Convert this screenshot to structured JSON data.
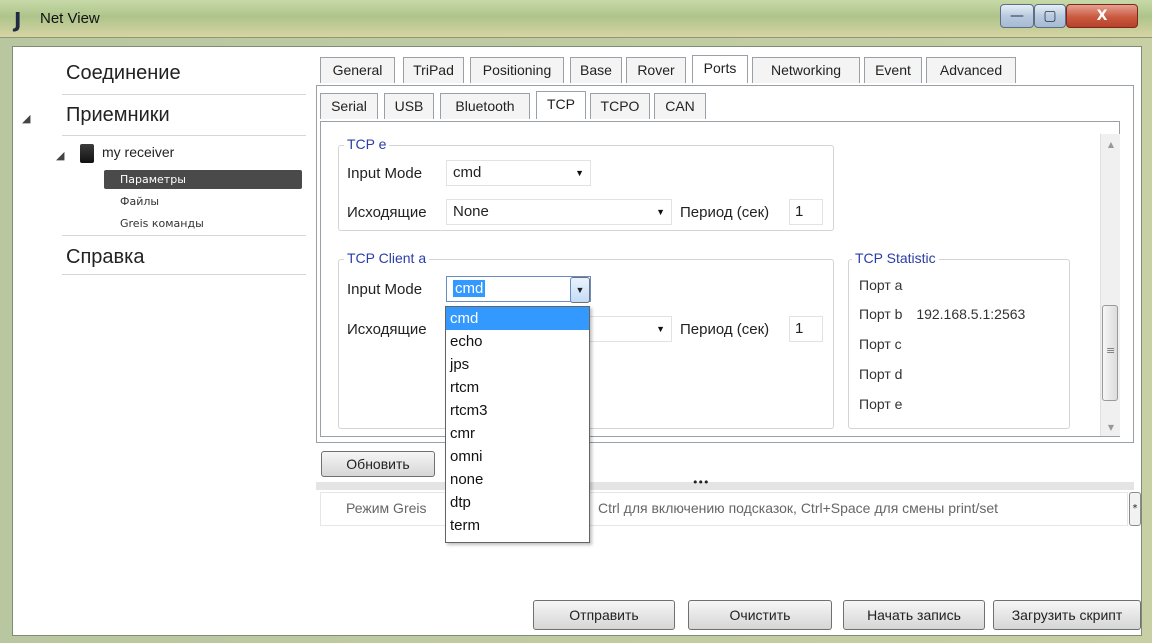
{
  "window": {
    "title": "Net View",
    "logo_glyph": "J",
    "minimize_glyph": "—",
    "maximize_glyph": "▢",
    "close_glyph": "X"
  },
  "sidebar": {
    "connection": "Соединение",
    "receivers": "Приемники",
    "receiver_name": "my receiver",
    "sub_items": [
      "Параметры",
      "Файлы",
      "Greis команды"
    ],
    "help": "Справка"
  },
  "main_tabs": [
    "General",
    "TriPad",
    "Positioning",
    "Base",
    "Rover",
    "Ports",
    "Networking",
    "Event",
    "Advanced"
  ],
  "sub_tabs": [
    "Serial",
    "USB",
    "Bluetooth",
    "TCP",
    "TCPO",
    "CAN"
  ],
  "tcp_e": {
    "title": "TCP e",
    "input_mode_label": "Input Mode",
    "input_mode_value": "cmd",
    "outgoing_label": "Исходящие",
    "outgoing_value": "None",
    "period_label": "Период (сек)",
    "period_value": "1"
  },
  "tcp_client_a": {
    "title": "TCP Client a",
    "input_mode_label": "Input Mode",
    "input_mode_value": "cmd",
    "outgoing_label": "Исходящие",
    "period_label": "Период (сек)",
    "period_value": "1"
  },
  "tcp_statistic": {
    "title": "TCP Statistic",
    "rows": [
      {
        "label": "Порт a",
        "value": ""
      },
      {
        "label": "Порт b",
        "value": "192.168.5.1:2563"
      },
      {
        "label": "Порт c",
        "value": ""
      },
      {
        "label": "Порт d",
        "value": ""
      },
      {
        "label": "Порт e",
        "value": ""
      }
    ]
  },
  "dropdown": {
    "options": [
      "cmd",
      "echo",
      "jps",
      "rtcm",
      "rtcm3",
      "cmr",
      "omni",
      "none",
      "dtp",
      "term"
    ],
    "selected": "cmd"
  },
  "refresh_button": "Обновить",
  "splitter_glyph": "•••",
  "console": {
    "hint_left": "Режим Greis",
    "hint_right": "Ctrl для включению подсказок, Ctrl+Space для смены print/set"
  },
  "bottom_buttons": {
    "send": "Отправить",
    "clear": "Очистить",
    "start_record": "Начать запись",
    "load_script": "Загрузить скрипт"
  },
  "colors": {
    "accent_blue": "#3399ff",
    "group_title": "#2a3ea8",
    "selected_nav": "#4a4a4a"
  }
}
